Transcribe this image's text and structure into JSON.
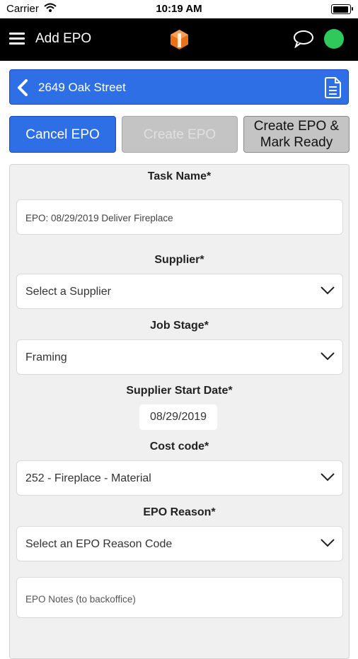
{
  "status_bar": {
    "carrier": "Carrier",
    "time": "10:19 AM"
  },
  "nav": {
    "title": "Add EPO",
    "status_color": "#2ec95a"
  },
  "address": {
    "text": "2649 Oak Street"
  },
  "actions": {
    "cancel_label": "Cancel EPO",
    "create_label": "Create EPO",
    "ready_label_line1": "Create EPO &",
    "ready_label_line2": "Mark Ready"
  },
  "form": {
    "task_name": {
      "label": "Task Name*",
      "value": "EPO: 08/29/2019 Deliver Fireplace"
    },
    "supplier": {
      "label": "Supplier*",
      "value": "Select a Supplier"
    },
    "job_stage": {
      "label": "Job Stage*",
      "value": "Framing"
    },
    "supplier_start_date": {
      "label": "Supplier Start Date*",
      "value": "08/29/2019"
    },
    "cost_code": {
      "label": "Cost code*",
      "value": "252 - Fireplace - Material"
    },
    "epo_reason": {
      "label": "EPO Reason*",
      "value": "Select an EPO Reason Code"
    },
    "epo_notes": {
      "placeholder": "EPO Notes (to backoffice)"
    }
  },
  "colors": {
    "primary": "#2f6fe6",
    "disabled": "#c4c4c4",
    "nav_bg": "#000000",
    "logo": "#e8721c"
  },
  "icons": [
    "wifi-icon",
    "battery-icon",
    "hamburger-icon",
    "logo-icon",
    "chat-icon",
    "back-chevron-icon",
    "document-icon",
    "chevron-down-icon"
  ]
}
